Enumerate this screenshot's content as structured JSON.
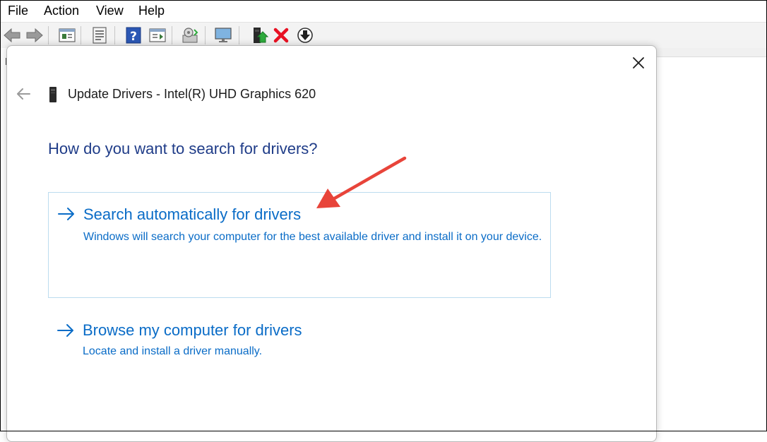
{
  "menubar": {
    "items": [
      "File",
      "Action",
      "View",
      "Help"
    ]
  },
  "toolbar": {
    "icons": [
      "back-arrow-icon",
      "forward-arrow-icon",
      "properties-icon",
      "list-view-icon",
      "help-icon",
      "action-pane-icon",
      "scan-hardware-icon",
      "monitor-icon",
      "update-driver-icon",
      "uninstall-icon",
      "disable-device-icon"
    ],
    "uninstall_color": "#e81123",
    "update_color": "#2eaa3c"
  },
  "dialog": {
    "title": "Update Drivers - Intel(R) UHD Graphics 620",
    "heading": "How do you want to search for drivers?",
    "options": [
      {
        "title": "Search automatically for drivers",
        "description": "Windows will search your computer for the best available driver and install it on your device."
      },
      {
        "title": "Browse my computer for drivers",
        "description": "Locate and install a driver manually."
      }
    ]
  },
  "colors": {
    "heading": "#1f3c88",
    "link": "#0a6cc7",
    "selected_border": "#bcdcef",
    "annotation_arrow": "#e8443a"
  }
}
